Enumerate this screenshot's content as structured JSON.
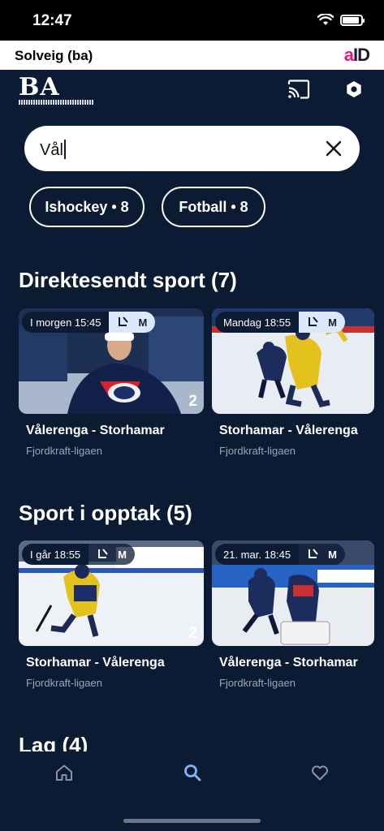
{
  "status_bar": {
    "time": "12:47"
  },
  "user_bar": {
    "name": "Solveig (ba)",
    "aid_logo_a": "a",
    "aid_logo_id": "ID"
  },
  "header": {
    "logo_text": "BA"
  },
  "search": {
    "value": "Vål"
  },
  "filters": [
    {
      "label": "Ishockey • 8"
    },
    {
      "label": "Fotball • 8"
    }
  ],
  "sections": {
    "live": {
      "title": "Direktesendt sport (7)",
      "cards": [
        {
          "time": "I morgen 15:45",
          "meta": "M",
          "count": "2",
          "title": "Vålerenga - Storhamar",
          "league": "Fjordkraft-ligaen"
        },
        {
          "time": "Mandag 18:55",
          "meta": "M",
          "count": "",
          "title": "Storhamar - Vålerenga",
          "league": "Fjordkraft-ligaen"
        }
      ]
    },
    "recorded": {
      "title": "Sport i opptak (5)",
      "cards": [
        {
          "time": "I går 18:55",
          "meta": "M",
          "count": "2",
          "title": "Storhamar - Vålerenga",
          "league": "Fjordkraft-ligaen"
        },
        {
          "time": "21. mar. 18:45",
          "meta": "M",
          "count": "",
          "title": "Vålerenga - Storhamar",
          "league": "Fjordkraft-ligaen"
        }
      ]
    },
    "teams": {
      "title": "Lag (4)"
    }
  },
  "nav": {
    "items": [
      "home-icon",
      "search-icon",
      "heart-icon"
    ],
    "active": "search-icon"
  },
  "colors": {
    "background": "#0b1b33",
    "accent": "#7db4f5",
    "aid_pink": "#e5197d"
  }
}
